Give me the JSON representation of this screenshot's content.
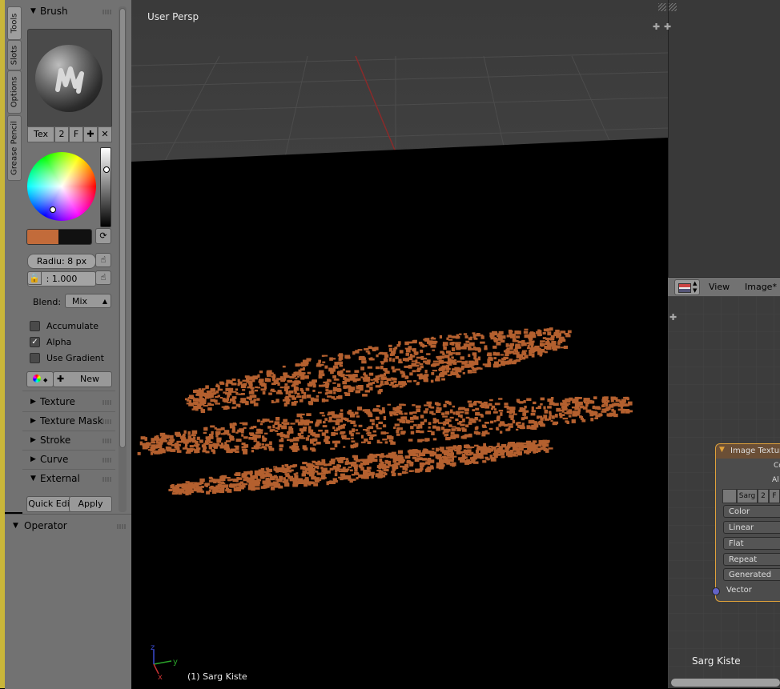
{
  "tool_tabs": [
    "Tools",
    "Slots",
    "Options",
    "Grease Pencil"
  ],
  "brush_panel": {
    "title": "Brush",
    "brush_buttons": {
      "tex": "Tex",
      "users": "2",
      "fake": "F"
    },
    "radius": "Radiu: 8 px",
    "strength": ": 1.000",
    "blend_label": "Blend:",
    "blend_value": "Mix",
    "accumulate": "Accumulate",
    "alpha": "Alpha",
    "use_gradient": "Use Gradient",
    "new_label": "New",
    "color_primary": "#c26b3a",
    "color_secondary": "#111111",
    "alpha_checked": true
  },
  "collapsed_panels": [
    "Texture",
    "Texture Mask",
    "Stroke",
    "Curve"
  ],
  "external_panel": {
    "title": "External",
    "quick_edit": "Quick Edi",
    "apply": "Apply"
  },
  "operator_panel": {
    "title": "Operator"
  },
  "viewport": {
    "title": "User Persp",
    "object_label": "(1) Sarg Kiste",
    "axis_y": "y",
    "axis_x": "x",
    "axis_z": "z",
    "paint_color": "#b4602f"
  },
  "image_editor": {
    "menu_view": "View",
    "menu_image": "Image*"
  },
  "node_editor": {
    "node_title": "Image Texture",
    "socket_color": "Co",
    "socket_alpha": "Al",
    "image_name": "Sarg",
    "image_users": "2",
    "image_fake": "F",
    "options": [
      "Color",
      "Linear",
      "Flat",
      "Repeat",
      "Generated"
    ],
    "input_vector": "Vector",
    "material_label": "Sarg Kiste"
  }
}
